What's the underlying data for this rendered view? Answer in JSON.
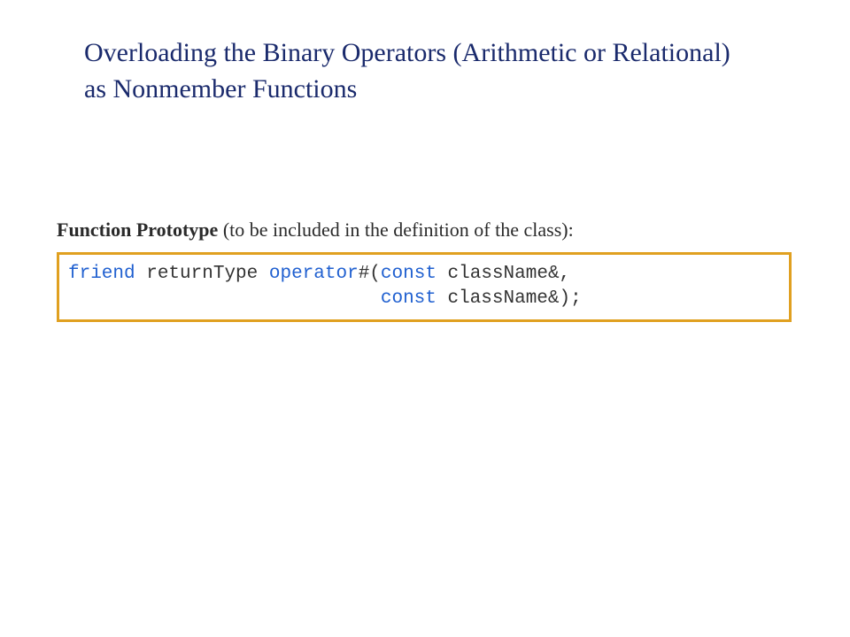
{
  "title": "Overloading the Binary Operators (Arithmetic or Relational) as Nonmember Functions",
  "prototype": {
    "label_bold": "Function Prototype",
    "label_rest": " (to be included in the definition of the class):"
  },
  "code": {
    "friend": "friend",
    "returnType": " returnType ",
    "operator": "operator",
    "hash_open": "#(",
    "const1": "const",
    "arg1": " className&,",
    "indent": "                            ",
    "const2": "const",
    "arg2": " className&);"
  }
}
